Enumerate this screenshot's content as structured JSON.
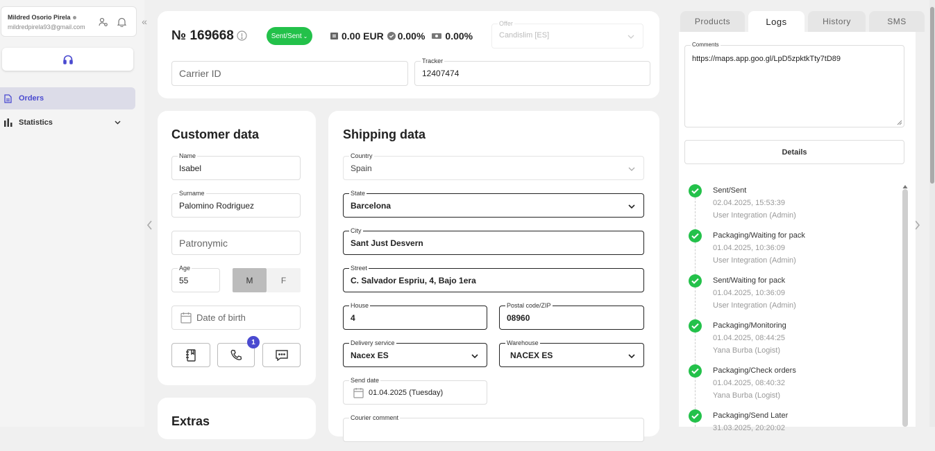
{
  "user": {
    "name": "Mildred Osorio Pirela",
    "email": "mildredpirela93@gmail.com"
  },
  "nav": {
    "items": [
      {
        "label": "Orders",
        "icon": "document-icon",
        "active": true
      },
      {
        "label": "Statistics",
        "icon": "bar-chart-icon",
        "active": false
      }
    ]
  },
  "order": {
    "number": "№ 169668",
    "status": "Sent/Sent",
    "amount": "0.00 EUR",
    "percent1": "0.00%",
    "percent2": "0.00%",
    "offer_label": "Offer",
    "offer_value": "Candislim [ES]",
    "carrier_placeholder": "Carrier ID",
    "tracker_label": "Tracker",
    "tracker_value": "12407474"
  },
  "customer": {
    "title": "Customer data",
    "name_label": "Name",
    "name": "Isabel",
    "surname_label": "Surname",
    "surname": "Palomino Rodriguez",
    "patronymic_placeholder": "Patronymic",
    "age_label": "Age",
    "age": "55",
    "gender_m": "M",
    "gender_f": "F",
    "dob_placeholder": "Date of birth",
    "call_badge": "1"
  },
  "extras": {
    "title": "Extras"
  },
  "shipping": {
    "title": "Shipping data",
    "country_label": "Country",
    "country": "Spain",
    "state_label": "State",
    "state": "Barcelona",
    "city_label": "City",
    "city": "Sant Just Desvern",
    "street_label": "Street",
    "street": "C. Salvador Espriu, 4, Bajo 1era",
    "house_label": "House",
    "house": "4",
    "postal_label": "Postal code/ZIP",
    "postal": "08960",
    "delivery_label": "Delivery service",
    "delivery": "Nacex ES",
    "warehouse_label": "Warehouse",
    "warehouse": "NACEX ES",
    "send_date_label": "Send date",
    "send_date": "01.04.2025 (Tuesday)",
    "courier_label": "Courier comment"
  },
  "right": {
    "tabs": [
      "Products",
      "Logs",
      "History",
      "SMS"
    ],
    "comments_label": "Comments",
    "comments_value": "https://maps.app.goo.gl/LpD5zpktkTty7tD89",
    "details_label": "Details",
    "logs": [
      {
        "title": "Sent/Sent",
        "date": "02.04.2025, 15:53:39",
        "user": "User Integration (Admin)"
      },
      {
        "title": "Packaging/Waiting for pack",
        "date": "01.04.2025, 10:36:09",
        "user": "User Integration (Admin)"
      },
      {
        "title": "Sent/Waiting for pack",
        "date": "01.04.2025, 10:36:09",
        "user": "User Integration (Admin)"
      },
      {
        "title": "Packaging/Monitoring",
        "date": "01.04.2025, 08:44:25",
        "user": "Yana Burba (Logist)"
      },
      {
        "title": "Packaging/Check orders",
        "date": "01.04.2025, 08:40:32",
        "user": "Yana Burba (Logist)"
      },
      {
        "title": "Packaging/Send Later",
        "date": "31.03.2025, 20:20:02",
        "user": ""
      }
    ]
  },
  "colors": {
    "accent": "#4a4ad0",
    "success": "#23c14a"
  }
}
